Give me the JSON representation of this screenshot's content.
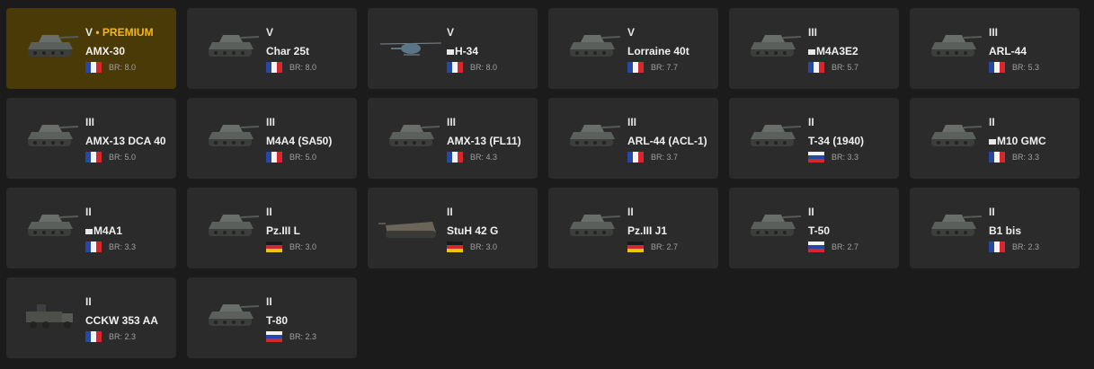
{
  "colors": {
    "background": "#1b1b1b",
    "card": "#2b2b2b",
    "premium_card": "#4a3a08",
    "premium_text": "#f2b81b"
  },
  "vehicles": [
    {
      "tier": "V",
      "premium_label": "• PREMIUM",
      "name": "AMX-30",
      "nation": "france",
      "br": "BR: 8.0",
      "premium": true,
      "icon": "tank-icon"
    },
    {
      "tier": "V",
      "name": "Char 25t",
      "nation": "france",
      "br": "BR: 8.0",
      "icon": "tank-icon"
    },
    {
      "tier": "V",
      "name": "H-34",
      "nation": "france",
      "br": "BR: 8.0",
      "mark": true,
      "icon": "helicopter-icon"
    },
    {
      "tier": "V",
      "name": "Lorraine 40t",
      "nation": "france",
      "br": "BR: 7.7",
      "icon": "tank-icon"
    },
    {
      "tier": "III",
      "name": "M4A3E2",
      "nation": "france",
      "br": "BR: 5.7",
      "mark": true,
      "icon": "tank-icon"
    },
    {
      "tier": "III",
      "name": "ARL-44",
      "nation": "france",
      "br": "BR: 5.3",
      "icon": "tank-icon"
    },
    {
      "tier": "III",
      "name": "AMX-13 DCA 40",
      "nation": "france",
      "br": "BR: 5.0",
      "icon": "spaa-icon"
    },
    {
      "tier": "III",
      "name": "M4A4 (SA50)",
      "nation": "france",
      "br": "BR: 5.0",
      "icon": "tank-icon"
    },
    {
      "tier": "III",
      "name": "AMX-13 (FL11)",
      "nation": "france",
      "br": "BR: 4.3",
      "icon": "tank-icon"
    },
    {
      "tier": "III",
      "name": "ARL-44 (ACL-1)",
      "nation": "france",
      "br": "BR: 3.7",
      "icon": "tank-icon"
    },
    {
      "tier": "II",
      "name": "T-34 (1940)",
      "nation": "russia",
      "br": "BR: 3.3",
      "icon": "tank-icon"
    },
    {
      "tier": "II",
      "name": "M10 GMC",
      "nation": "france",
      "br": "BR: 3.3",
      "mark": true,
      "icon": "tank-destroyer-icon"
    },
    {
      "tier": "II",
      "name": "M4A1",
      "nation": "france",
      "br": "BR: 3.3",
      "mark": true,
      "icon": "tank-icon"
    },
    {
      "tier": "II",
      "name": "Pz.III L",
      "nation": "germany",
      "br": "BR: 3.0",
      "icon": "tank-icon"
    },
    {
      "tier": "II",
      "name": "StuH 42 G",
      "nation": "germany",
      "br": "BR: 3.0",
      "icon": "assault-gun-icon"
    },
    {
      "tier": "II",
      "name": "Pz.III J1",
      "nation": "germany",
      "br": "BR: 2.7",
      "icon": "tank-icon"
    },
    {
      "tier": "II",
      "name": "T-50",
      "nation": "russia",
      "br": "BR: 2.7",
      "icon": "tank-icon"
    },
    {
      "tier": "II",
      "name": "B1 bis",
      "nation": "france",
      "br": "BR: 2.3",
      "icon": "tank-icon"
    },
    {
      "tier": "II",
      "name": "CCKW 353 AA",
      "nation": "france",
      "br": "BR: 2.3",
      "icon": "truck-icon"
    },
    {
      "tier": "II",
      "name": "T-80",
      "nation": "russia",
      "br": "BR: 2.3",
      "icon": "tank-icon"
    }
  ]
}
